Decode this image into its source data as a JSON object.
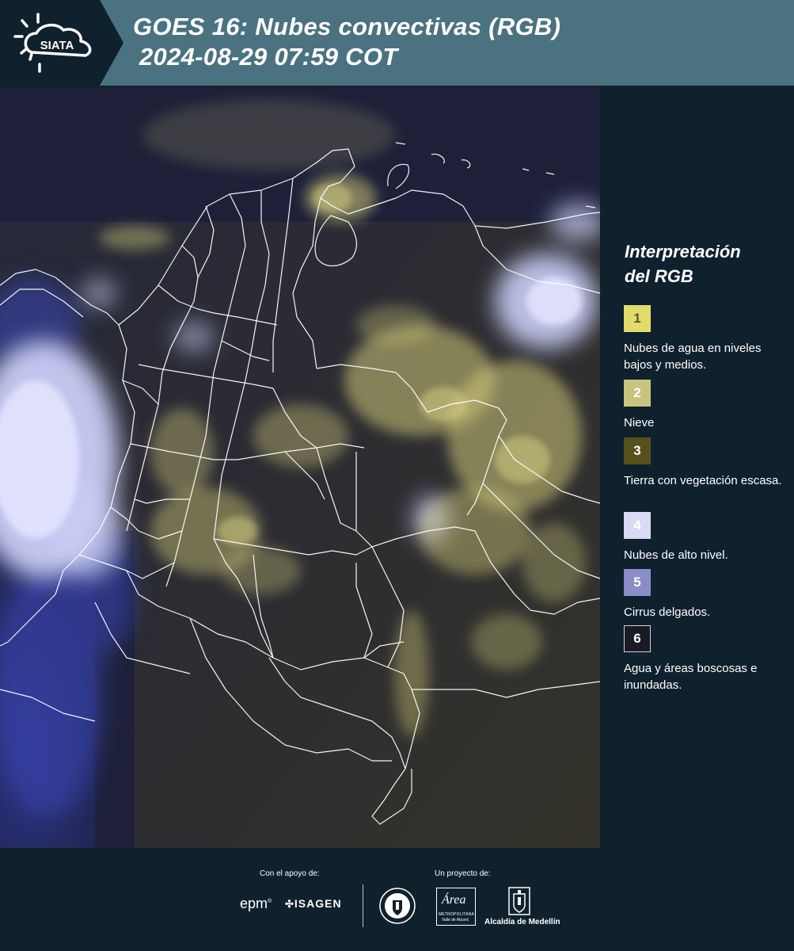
{
  "header": {
    "logo_text": "SIATA",
    "title_line1": "GOES 16: Nubes convectivas (RGB)",
    "title_line2": "2024-08-29 07:59 COT"
  },
  "map": {
    "product": "Nubes convectivas (RGB)",
    "satellite": "GOES 16",
    "colors": {
      "background_land": "#2b2a33",
      "low_clouds": "#d8d27a",
      "high_clouds": "#c9cdf6",
      "thin_cirrus": "#5c62c8",
      "boundaries": "#ffffff"
    }
  },
  "legend": {
    "title_line1": "Interpretación",
    "title_line2": "del RGB",
    "items": [
      {
        "number": "1",
        "label": "Nubes de agua en niveles bajos y medios.",
        "color": "#e2dd6b",
        "text_color": "#5a5a20"
      },
      {
        "number": "2",
        "label": "Nieve",
        "color": "#c7c47e",
        "text_color": "#ffffff"
      },
      {
        "number": "3",
        "label": "Tierra con vegetación escasa.",
        "color": "#57521d",
        "text_color": "#ffffff"
      },
      {
        "number": "4",
        "label": "Nubes de alto nivel.",
        "color": "#d8daf6",
        "text_color": "#ffffff"
      },
      {
        "number": "5",
        "label": "Cirrus delgados.",
        "color": "#8b8dc8",
        "text_color": "#ffffff"
      },
      {
        "number": "6",
        "label": "Agua y áreas boscosas e inundadas.",
        "color": "#1a1a24",
        "text_color": "#ffffff"
      }
    ]
  },
  "footer": {
    "support_label": "Con el apoyo de:",
    "project_label": "Un proyecto de:",
    "sponsors": [
      "epm",
      "ISAGEN"
    ],
    "partners": [
      "Área Metropolitana Valle de Aburrá",
      "Alcaldía de Medellín"
    ],
    "epm_mark": "®",
    "area_logo_text": "Área",
    "area_line1": "METROPOLITANA",
    "area_line2": "Valle de Aburrá"
  }
}
